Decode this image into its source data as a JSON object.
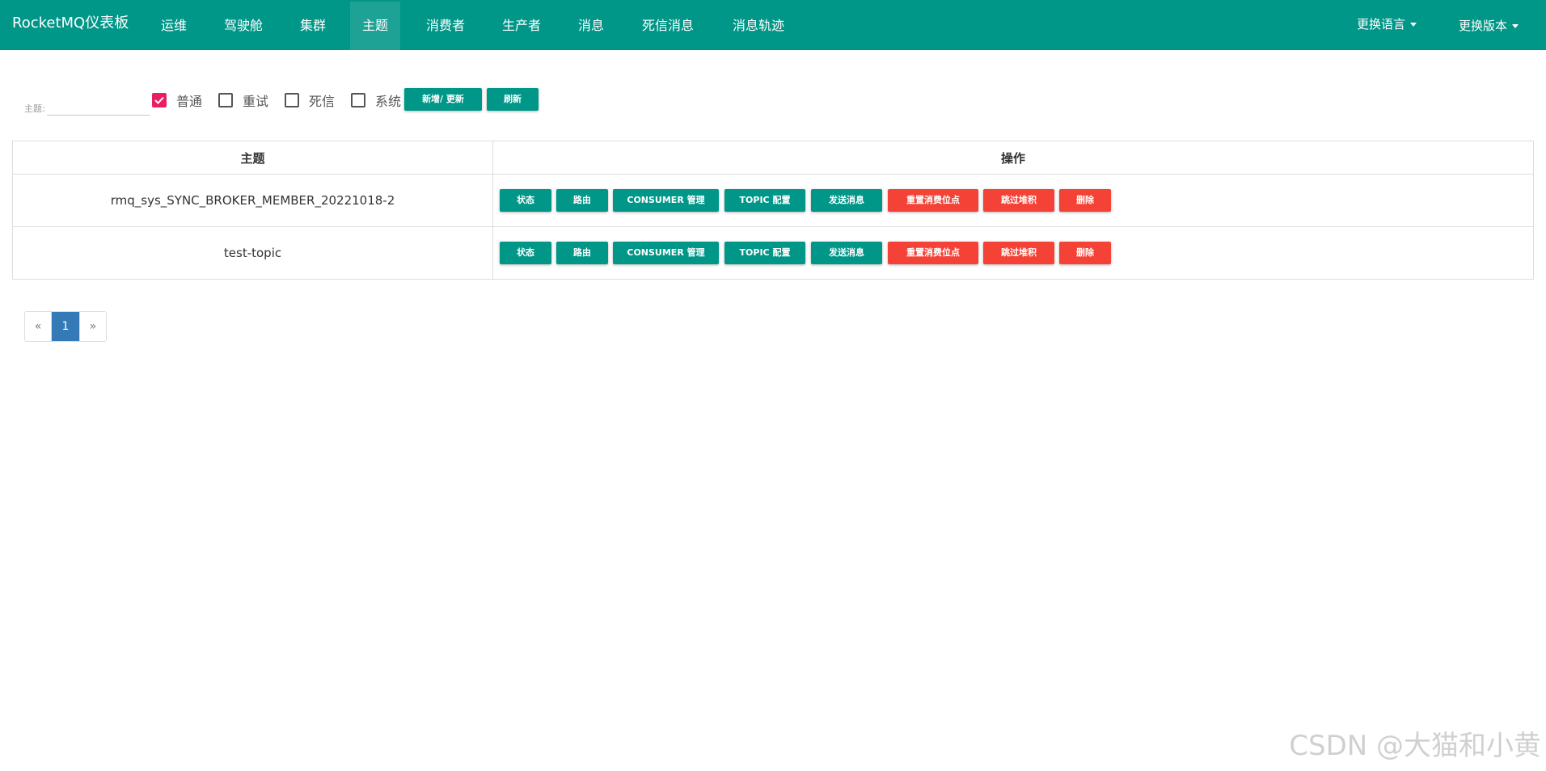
{
  "nav": {
    "brand": "RocketMQ仪表板",
    "items": [
      "运维",
      "驾驶舱",
      "集群",
      "主题",
      "消费者",
      "生产者",
      "消息",
      "死信消息",
      "消息轨迹"
    ],
    "language": "更换语言",
    "version": "更换版本"
  },
  "filter": {
    "topic_label": "主题:",
    "topic_value": "",
    "checkboxes": [
      {
        "label": "普通",
        "checked": true
      },
      {
        "label": "重试",
        "checked": false
      },
      {
        "label": "死信",
        "checked": false
      },
      {
        "label": "系统",
        "checked": false
      }
    ],
    "add_update": "新增/ 更新",
    "refresh": "刷新"
  },
  "table": {
    "headers": [
      "主题",
      "操作"
    ],
    "rows": [
      {
        "topic": "rmq_sys_SYNC_BROKER_MEMBER_20221018-2"
      },
      {
        "topic": "test-topic"
      }
    ],
    "actions": {
      "status": "状态",
      "route": "路由",
      "consumer": "CONSUMER 管理",
      "topic_config": "TOPIC 配置",
      "send": "发送消息",
      "reset_offset": "重置消费位点",
      "skip_backlog": "跳过堆积",
      "delete": "删除"
    }
  },
  "pagination": {
    "prev": "«",
    "current": "1",
    "next": "»"
  },
  "watermark": "CSDN @大猫和小黄",
  "colors": {
    "primary": "#009688",
    "danger": "#f44336",
    "checked": "#e91e63",
    "page_active": "#337ab7"
  }
}
